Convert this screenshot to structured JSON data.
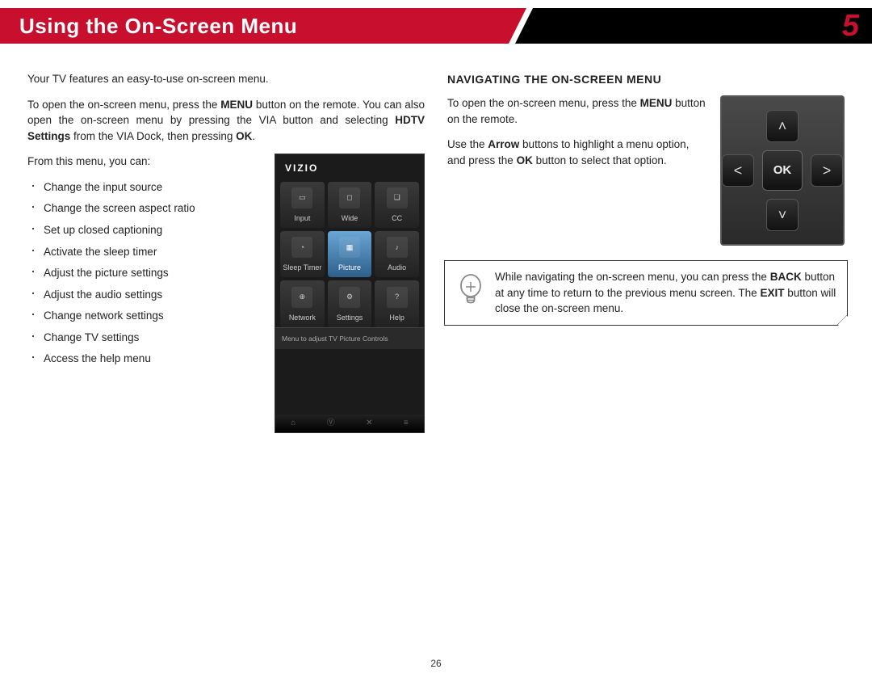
{
  "header": {
    "title": "Using the On-Screen Menu",
    "chapter": "5"
  },
  "left_col": {
    "intro": "Your TV features an easy-to-use on-screen menu.",
    "open_instruction_pre": "To open the on-screen menu, press the ",
    "open_instruction_bold1": "MENU",
    "open_instruction_mid": " button on the remote. You can also open the on-screen menu by pressing the VIA button and selecting ",
    "open_instruction_bold2": "HDTV Settings",
    "open_instruction_post": " from the VIA Dock, then pressing ",
    "open_instruction_bold3": "OK",
    "open_instruction_end": ".",
    "from_this": "From this menu, you can:",
    "bullets": [
      "Change the input source",
      "Change the screen aspect ratio",
      "Set up closed captioning",
      "Activate the sleep timer",
      "Adjust the picture settings",
      "Adjust the audio settings",
      "Change network settings",
      "Change TV settings",
      "Access the help menu"
    ]
  },
  "tv_menu": {
    "brand": "VIZIO",
    "tiles": [
      {
        "label": "Input"
      },
      {
        "label": "Wide"
      },
      {
        "label": "CC"
      },
      {
        "label": "Sleep Timer"
      },
      {
        "label": "Picture",
        "selected": true
      },
      {
        "label": "Audio"
      },
      {
        "label": "Network"
      },
      {
        "label": "Settings"
      },
      {
        "label": "Help"
      }
    ],
    "caption": "Menu to adjust TV Picture Controls"
  },
  "right_col": {
    "heading": "NAVIGATING THE ON-SCREEN MENU",
    "p1_pre": "To open the on-screen menu, press the ",
    "p1_bold": "MENU",
    "p1_post": " button on the remote.",
    "p2_pre": "Use the ",
    "p2_bold1": "Arrow",
    "p2_mid": " buttons to highlight a menu option, and press the ",
    "p2_bold2": "OK",
    "p2_post": " button to select that option.",
    "ok_label": "OK",
    "tip_pre": "While navigating the on-screen menu, you can press the ",
    "tip_bold1": "BACK",
    "tip_mid": " button at any time to return to the previous menu screen. The ",
    "tip_bold2": "EXIT",
    "tip_post": " button will close the on-screen menu."
  },
  "page_number": "26"
}
